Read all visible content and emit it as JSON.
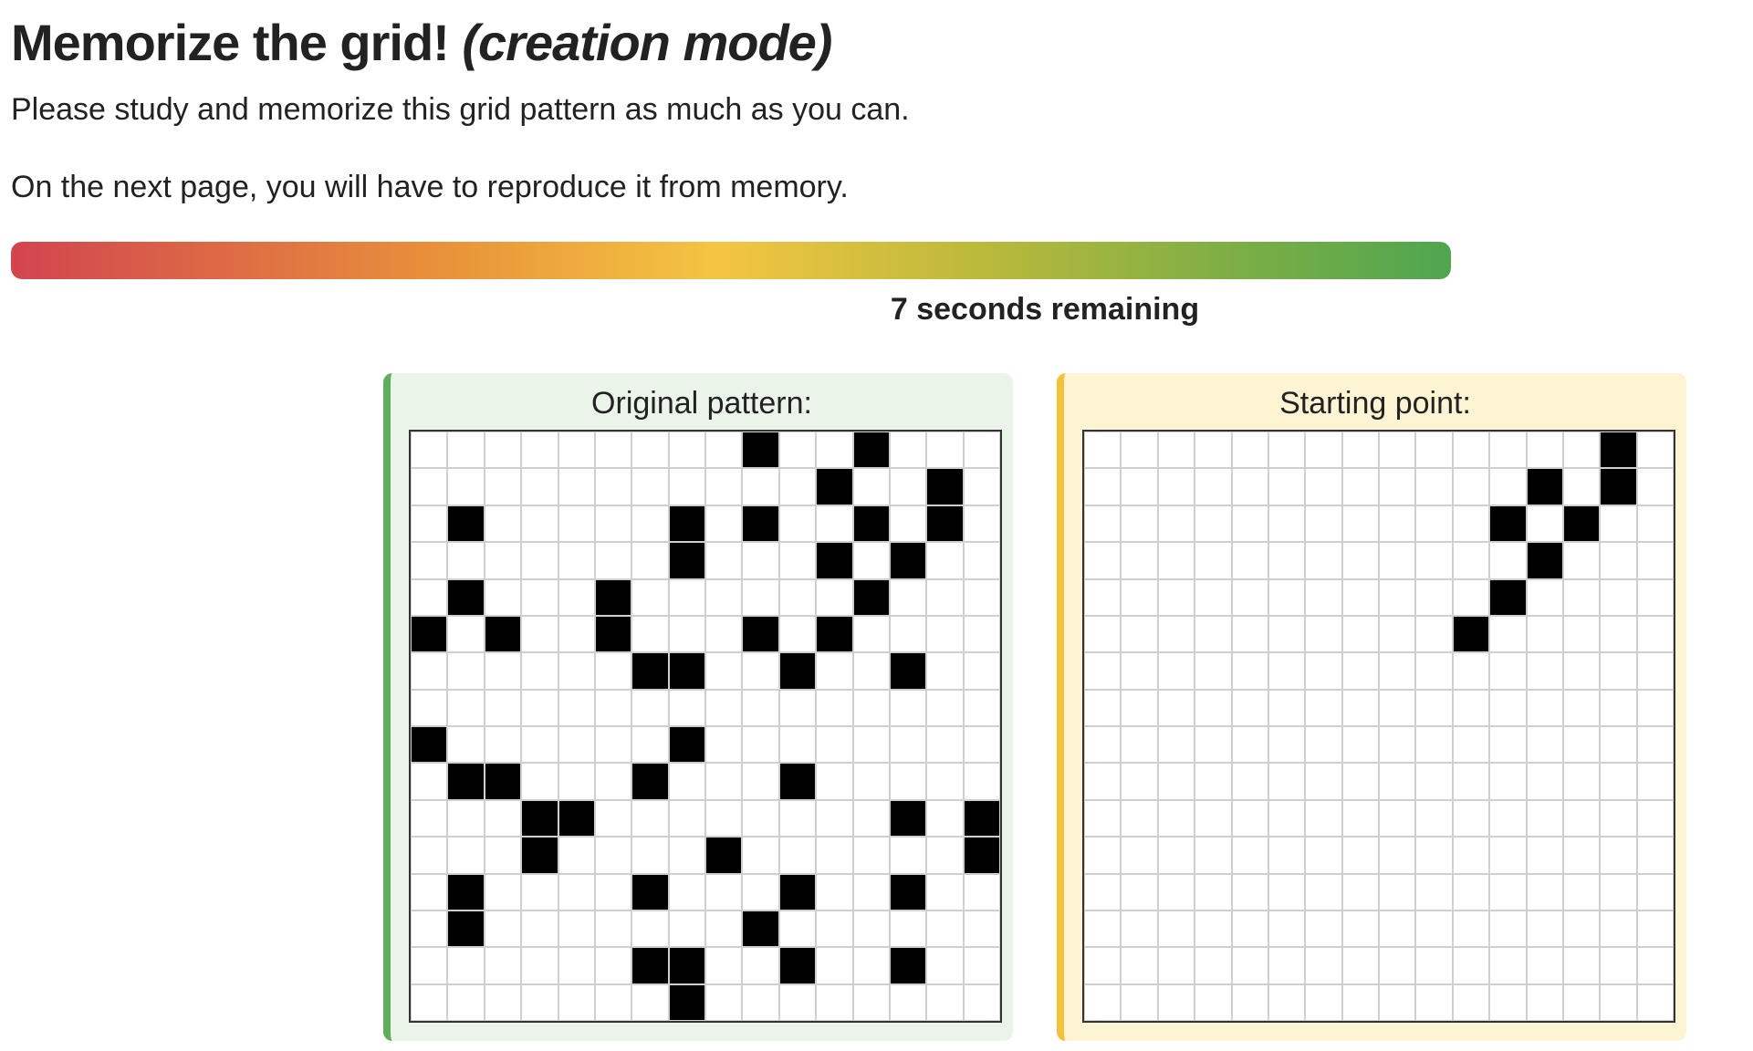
{
  "header": {
    "title": "Memorize the grid!",
    "mode": "(creation mode)"
  },
  "instructions": {
    "line1": "Please study and memorize this grid pattern as much as you can.",
    "line2": "On the next page, you will have to reproduce it from memory."
  },
  "timer": {
    "label": "7 seconds remaining",
    "progress_fraction": 1.0,
    "gradient_colors": [
      "#d2444f",
      "#e8923a",
      "#f4c542",
      "#b9b93b",
      "#7cae45",
      "#4fa64f"
    ]
  },
  "original_panel": {
    "title": "Original pattern:",
    "accent_color": "#5fae5c",
    "rows": 16,
    "cols": 16,
    "filled_cells": [
      [
        0,
        9
      ],
      [
        0,
        12
      ],
      [
        1,
        11
      ],
      [
        1,
        14
      ],
      [
        2,
        1
      ],
      [
        2,
        7
      ],
      [
        2,
        9
      ],
      [
        2,
        12
      ],
      [
        2,
        14
      ],
      [
        3,
        7
      ],
      [
        3,
        11
      ],
      [
        3,
        13
      ],
      [
        4,
        1
      ],
      [
        4,
        5
      ],
      [
        4,
        12
      ],
      [
        5,
        0
      ],
      [
        5,
        2
      ],
      [
        5,
        5
      ],
      [
        5,
        9
      ],
      [
        5,
        11
      ],
      [
        6,
        6
      ],
      [
        6,
        7
      ],
      [
        6,
        10
      ],
      [
        6,
        13
      ],
      [
        8,
        0
      ],
      [
        8,
        7
      ],
      [
        9,
        1
      ],
      [
        9,
        2
      ],
      [
        9,
        6
      ],
      [
        9,
        10
      ],
      [
        10,
        3
      ],
      [
        10,
        4
      ],
      [
        10,
        13
      ],
      [
        10,
        15
      ],
      [
        11,
        3
      ],
      [
        11,
        8
      ],
      [
        11,
        15
      ],
      [
        12,
        1
      ],
      [
        12,
        6
      ],
      [
        12,
        10
      ],
      [
        12,
        13
      ],
      [
        13,
        1
      ],
      [
        13,
        9
      ],
      [
        14,
        6
      ],
      [
        14,
        7
      ],
      [
        14,
        10
      ],
      [
        14,
        13
      ],
      [
        15,
        7
      ]
    ]
  },
  "starting_panel": {
    "title": "Starting point:",
    "accent_color": "#f4c13a",
    "rows": 16,
    "cols": 16,
    "filled_cells": [
      [
        0,
        14
      ],
      [
        1,
        12
      ],
      [
        1,
        14
      ],
      [
        2,
        11
      ],
      [
        2,
        13
      ],
      [
        3,
        12
      ],
      [
        4,
        11
      ],
      [
        5,
        10
      ]
    ]
  }
}
